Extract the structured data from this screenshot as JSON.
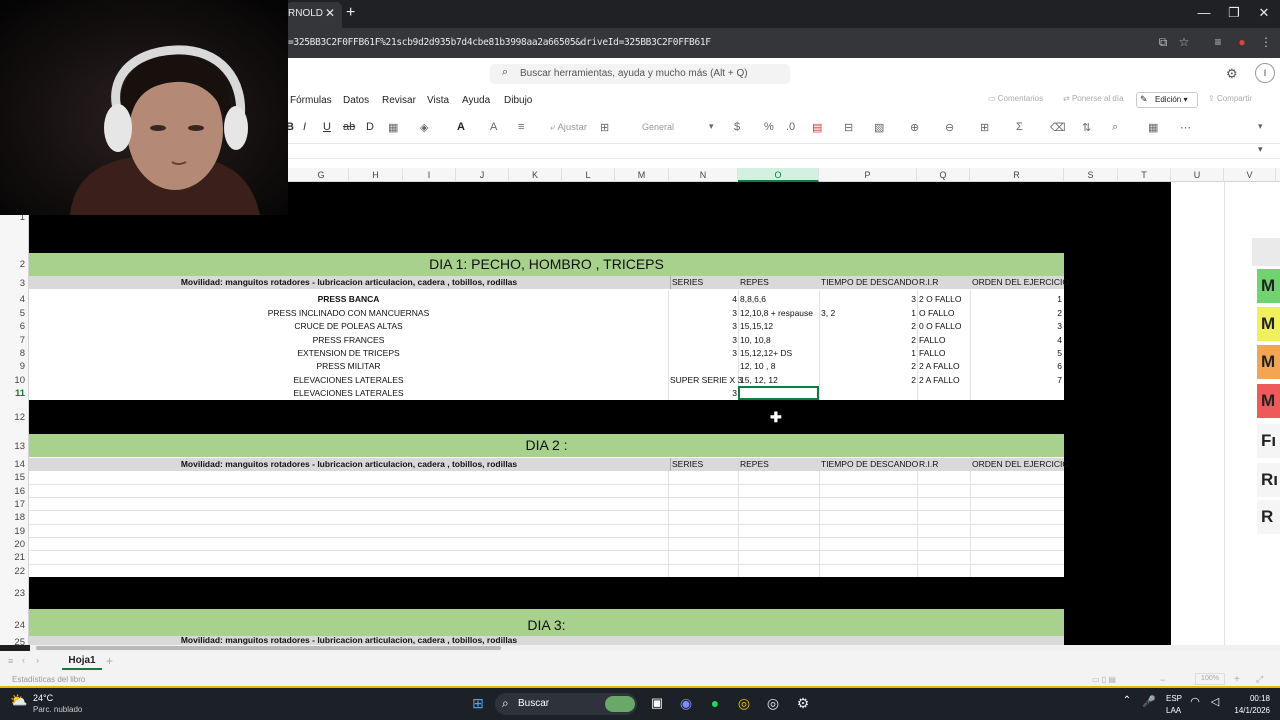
{
  "browser": {
    "tab_title": "RNOLD",
    "tab_close": "✕",
    "new_tab": "+",
    "url": "=325BB3C2F0FFB61F%21scb9d2d935b7d4cbe81b3998aa2a66505&driveId=325BB3C2F0FFB61F",
    "window_controls": [
      "—",
      "❐",
      "✕"
    ]
  },
  "excel": {
    "search_placeholder": "Buscar herramientas, ayuda y mucho más (Alt + Q)",
    "menu": [
      "Fórmulas",
      "Datos",
      "Revisar",
      "Vista",
      "Ayuda",
      "Dibujo"
    ],
    "comments_label": "Comentarios",
    "catchup_label": "Ponerse al día",
    "mode_label": "Edición",
    "share_label": "Compartir",
    "wrap_label": "Ajustar",
    "number_format": "General",
    "columns": [
      "G",
      "H",
      "I",
      "J",
      "K",
      "L",
      "M",
      "N",
      "O",
      "P",
      "Q",
      "R",
      "S",
      "T",
      "U",
      "V"
    ],
    "row_numbers": [
      "1",
      "2",
      "3",
      "4",
      "5",
      "6",
      "7",
      "8",
      "9",
      "10",
      "11",
      "12",
      "13",
      "14",
      "15",
      "16",
      "17",
      "18",
      "19",
      "20",
      "21",
      "22",
      "23",
      "24",
      "25"
    ],
    "sheet_tab": "Hoja1",
    "status_text": "Estadísticas del libro",
    "zoom": "100%"
  },
  "sheet": {
    "day1_title": "DIA 1: PECHO, HOMBRO , TRICEPS",
    "day2_title": "DIA 2 :",
    "day3_title": "DIA 3:",
    "mobility": "Movilidad: manguitos rotadores - lubricacion articulacion, cadera , tobillos, rodillas",
    "headers": [
      "SERIES",
      "REPES",
      "TIEMPO DE DESCANDO",
      "R.I.R",
      "ORDEN DEL EJERCICIO"
    ],
    "exercises": [
      {
        "name": "PRESS BANCA",
        "series": "4",
        "repes": "8,8,6,6",
        "descanso": "",
        "descanso_n": "3",
        "rir": "2 O FALLO",
        "orden": "1",
        "bold": true
      },
      {
        "name": "PRESS INCLINADO CON MANCUERNAS",
        "series": "3",
        "repes": "12,10,8 + respause",
        "descanso": "3, 2",
        "descanso_n": "1",
        "rir": "O FALLO",
        "orden": "2"
      },
      {
        "name": "CRUCE DE POLEAS ALTAS",
        "series": "3",
        "repes": "15,15,12",
        "descanso": "",
        "descanso_n": "2",
        "rir": "0 O FALLO",
        "orden": "3"
      },
      {
        "name": "PRESS FRANCES",
        "series": "3",
        "repes": "10, 10,8",
        "descanso": "",
        "descanso_n": "2",
        "rir": "FALLO",
        "orden": "4"
      },
      {
        "name": "EXTENSION DE TRICEPS",
        "series": "3",
        "repes": "15,12,12+ DS",
        "descanso": "",
        "descanso_n": "1",
        "rir": "FALLO",
        "orden": "5"
      },
      {
        "name": "PRESS MILITAR",
        "series": "",
        "repes": "12, 10 , 8",
        "descanso": "",
        "descanso_n": "2",
        "rir": "2 A FALLO",
        "orden": "6"
      },
      {
        "name": "ELEVACIONES LATERALES",
        "series": "SUPER SERIE X 3",
        "repes": "15, 12, 12",
        "descanso": "",
        "descanso_n": "2",
        "rir": "2 A FALLO",
        "orden": "7"
      },
      {
        "name": "ELEVACIONES LATERALES",
        "series": "3",
        "repes": "",
        "descanso": "",
        "descanso_n": "",
        "rir": "",
        "orden": ""
      }
    ],
    "side_labels": [
      "M",
      "M",
      "M",
      "M",
      "Fı",
      "Rı",
      "R"
    ],
    "side_colors": [
      "#6fd36f",
      "#f2ef5c",
      "#f2a654",
      "#ee5a5a",
      "#f5f5f5",
      "#f5f5f5",
      "#f5f5f5"
    ]
  },
  "taskbar": {
    "weather_temp": "24°C",
    "weather_desc": "Parc. nublado",
    "search_label": "Buscar",
    "lang1": "ESP",
    "lang2": "LAA",
    "time": "00:18",
    "date": "14/1/2026"
  }
}
